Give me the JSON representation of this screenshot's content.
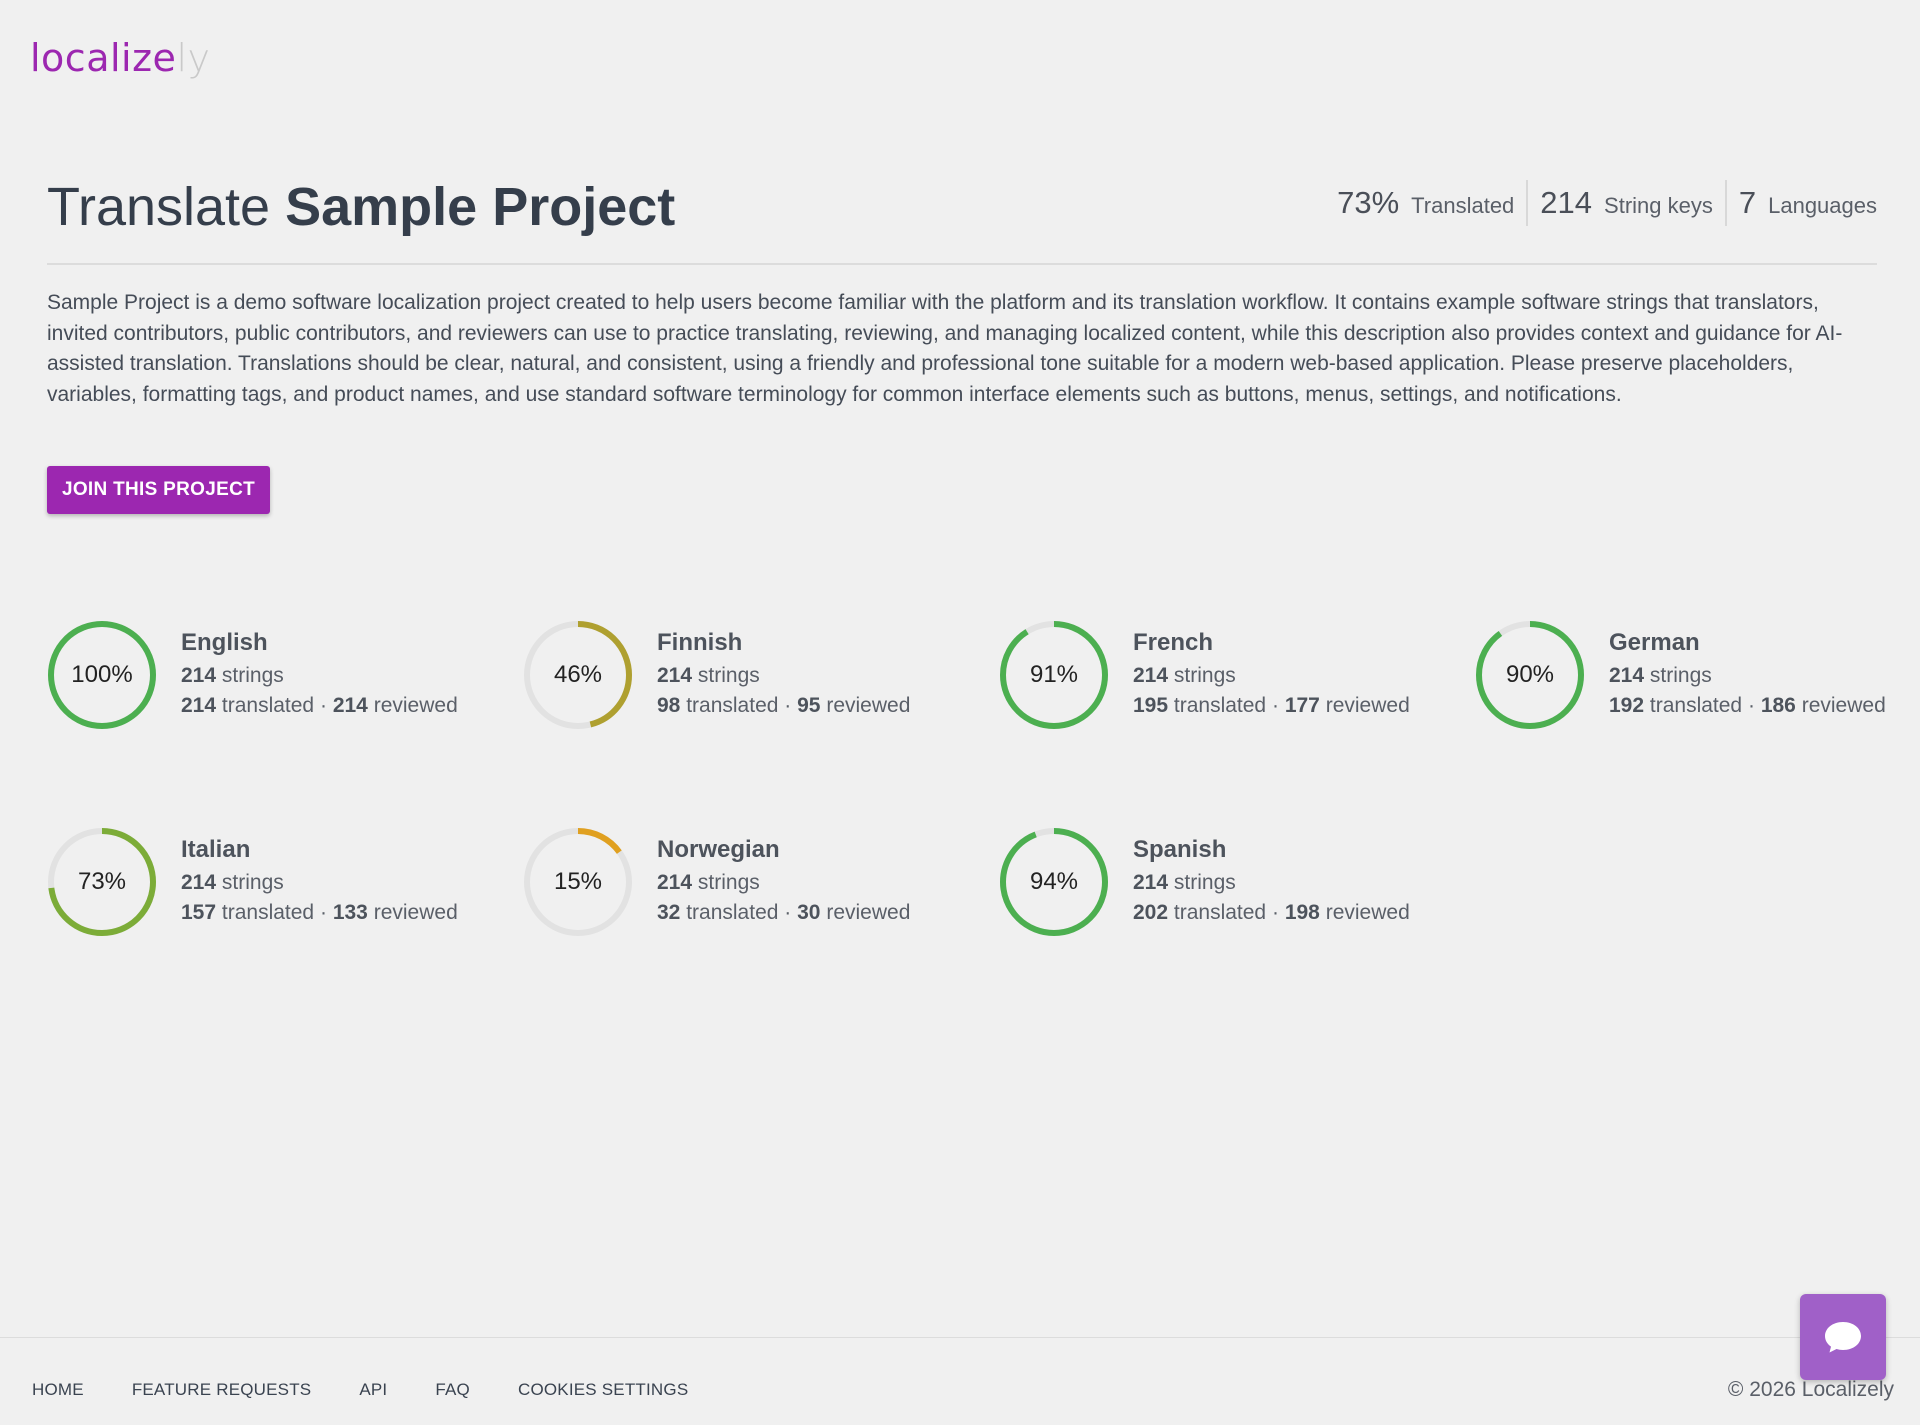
{
  "brand": {
    "main": "localize",
    "suffix": "ly",
    "color": "#9c27b0"
  },
  "header": {
    "title_prefix": "Translate",
    "project_name": "Sample Project",
    "stats": [
      {
        "value": "73%",
        "label": "Translated"
      },
      {
        "value": "214",
        "label": "String keys"
      },
      {
        "value": "7",
        "label": "Languages"
      }
    ]
  },
  "description": "Sample Project is a demo software localization project created to help users become familiar with the platform and its translation workflow. It contains example software strings that translators, invited contributors, public contributors, and reviewers can use to practice translating, reviewing, and managing localized content, while this description also provides context and guidance for AI-assisted translation. Translations should be clear, natural, and consistent, using a friendly and professional tone suitable for a modern web-based application. Please preserve placeholders, variables, formatting tags, and product names, and use standard software terminology for common interface elements such as buttons, menus, settings, and notifications.",
  "join_button": "JOIN THIS PROJECT",
  "languages": [
    {
      "name": "English",
      "percent": "100%",
      "progress": 1.0,
      "color": "#4caf50",
      "strings": "214",
      "strings_label": "strings",
      "translated": "214",
      "translated_label": "translated",
      "sep": "·",
      "reviewed": "214",
      "reviewed_label": "reviewed"
    },
    {
      "name": "Finnish",
      "percent": "46%",
      "progress": 0.46,
      "color": "#afa030",
      "strings": "214",
      "strings_label": "strings",
      "translated": "98",
      "translated_label": "translated",
      "sep": "·",
      "reviewed": "95",
      "reviewed_label": "reviewed"
    },
    {
      "name": "French",
      "percent": "91%",
      "progress": 0.91,
      "color": "#4caf50",
      "strings": "214",
      "strings_label": "strings",
      "translated": "195",
      "translated_label": "translated",
      "sep": "·",
      "reviewed": "177",
      "reviewed_label": "reviewed"
    },
    {
      "name": "German",
      "percent": "90%",
      "progress": 0.9,
      "color": "#4caf50",
      "strings": "214",
      "strings_label": "strings",
      "translated": "192",
      "translated_label": "translated",
      "sep": "·",
      "reviewed": "186",
      "reviewed_label": "reviewed"
    },
    {
      "name": "Italian",
      "percent": "73%",
      "progress": 0.73,
      "color": "#7cac38",
      "strings": "214",
      "strings_label": "strings",
      "translated": "157",
      "translated_label": "translated",
      "sep": "·",
      "reviewed": "133",
      "reviewed_label": "reviewed"
    },
    {
      "name": "Norwegian",
      "percent": "15%",
      "progress": 0.15,
      "color": "#e0a020",
      "strings": "214",
      "strings_label": "strings",
      "translated": "32",
      "translated_label": "translated",
      "sep": "·",
      "reviewed": "30",
      "reviewed_label": "reviewed"
    },
    {
      "name": "Spanish",
      "percent": "94%",
      "progress": 0.94,
      "color": "#4caf50",
      "strings": "214",
      "strings_label": "strings",
      "translated": "202",
      "translated_label": "translated",
      "sep": "·",
      "reviewed": "198",
      "reviewed_label": "reviewed"
    }
  ],
  "footer": {
    "links": [
      "HOME",
      "FEATURE REQUESTS",
      "API",
      "FAQ",
      "COOKIES SETTINGS"
    ],
    "copyright": "© 2026  Localizely"
  },
  "chat_button": {
    "icon": "chat-bubble-icon"
  }
}
